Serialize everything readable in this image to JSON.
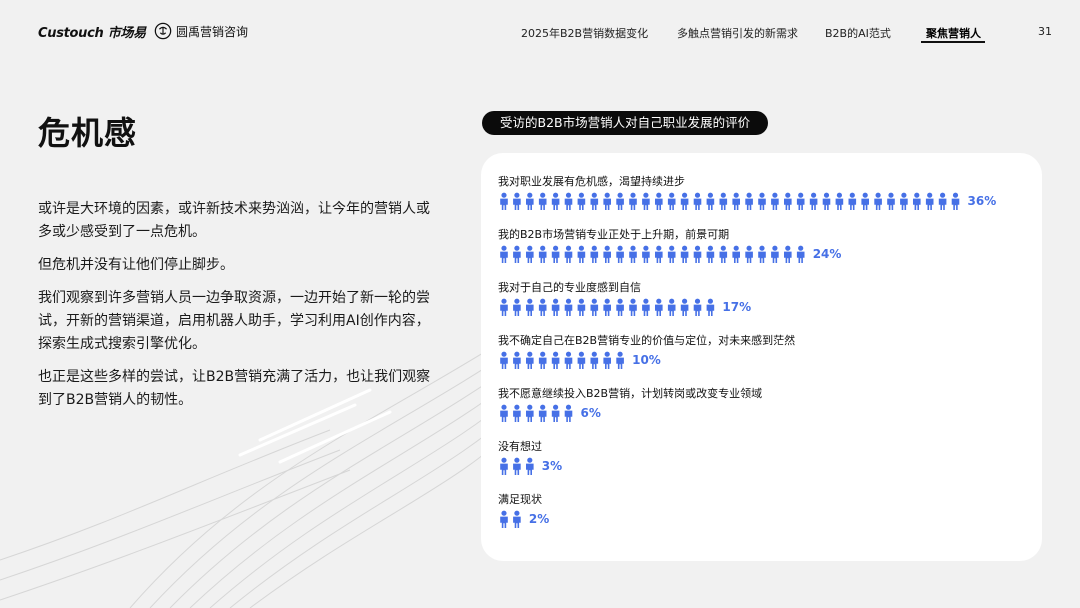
{
  "header": {
    "brand_logo": "Custouch 市场易",
    "partner_logo": "圆禹营销咨询",
    "nav": [
      {
        "label": "2025年B2B营销数据变化",
        "active": false
      },
      {
        "label": "多触点营销引发的新需求",
        "active": false
      },
      {
        "label": "B2B的AI范式",
        "active": false
      },
      {
        "label": "聚焦营销人",
        "active": true
      }
    ],
    "page_number": "31"
  },
  "main": {
    "title": "危机感",
    "paragraphs": [
      "或许是大环境的因素，或许新技术来势汹汹，让今年的营销人或多或少感受到了一点危机。",
      "但危机并没有让他们停止脚步。",
      "我们观察到许多营销人员一边争取资源，一边开始了新一轮的尝试，开新的营销渠道，启用机器人助手，学习利用AI创作内容，探索生成式搜索引擎优化。",
      "也正是这些多样的尝试，让B2B营销充满了活力，也让我们观察到了B2B营销人的韧性。"
    ]
  },
  "chart_data": {
    "type": "bar",
    "title": "受访的B2B市场营销人对自己职业发展的评价",
    "unit": "%",
    "categories": [
      "我对职业发展有危机感，渴望持续进步",
      "我的B2B市场营销专业正处于上升期，前景可期",
      "我对于自己的专业度感到自信",
      "我不确定自己在B2B营销专业的价值与定位，对未来感到茫然",
      "我不愿意继续投入B2B营销，计划转岗或改变专业领域",
      "没有想过",
      "满足现状"
    ],
    "values": [
      36,
      24,
      17,
      10,
      6,
      3,
      2
    ],
    "labels": [
      "36%",
      "24%",
      "17%",
      "10%",
      "6%",
      "3%",
      "2%"
    ],
    "icon": "person-pair-icon",
    "colors": {
      "icon": "#4670e6",
      "value_label": "#4670e6"
    }
  }
}
